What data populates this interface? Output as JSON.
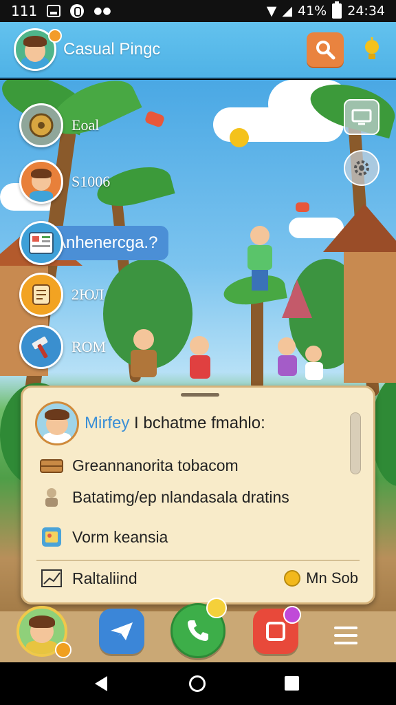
{
  "status_bar": {
    "left_text": "111",
    "battery": "41%",
    "time": "24:34"
  },
  "header": {
    "title": "Casual Pingc"
  },
  "side_menu": [
    {
      "label": "Eoal",
      "icon": "compass-icon"
    },
    {
      "label": "S1006",
      "icon": "profile-icon"
    },
    {
      "label": "Anhenercga.?",
      "icon": "book-icon"
    },
    {
      "label": "2ЮЛ",
      "icon": "scroll-icon"
    },
    {
      "label": "ROM",
      "icon": "hammer-icon"
    }
  ],
  "panel": {
    "title_highlight": "Mirfey",
    "title_rest": " I bchatme fmahlo:",
    "rows": [
      {
        "label": "Greannanorita tobacom",
        "icon": "crate-icon"
      },
      {
        "label": "Batatimg/ep nlandasala dratins",
        "icon": "villager-icon"
      },
      {
        "label": "Vorm keansia",
        "icon": "photo-icon"
      }
    ],
    "footer_label": "Raltaliind",
    "footer_right": "Mn Sob"
  },
  "colors": {
    "header": "#4fb2e6",
    "search": "#e9833f",
    "panel": "#f8ebc9",
    "accent_blue": "#3b8fd6"
  }
}
